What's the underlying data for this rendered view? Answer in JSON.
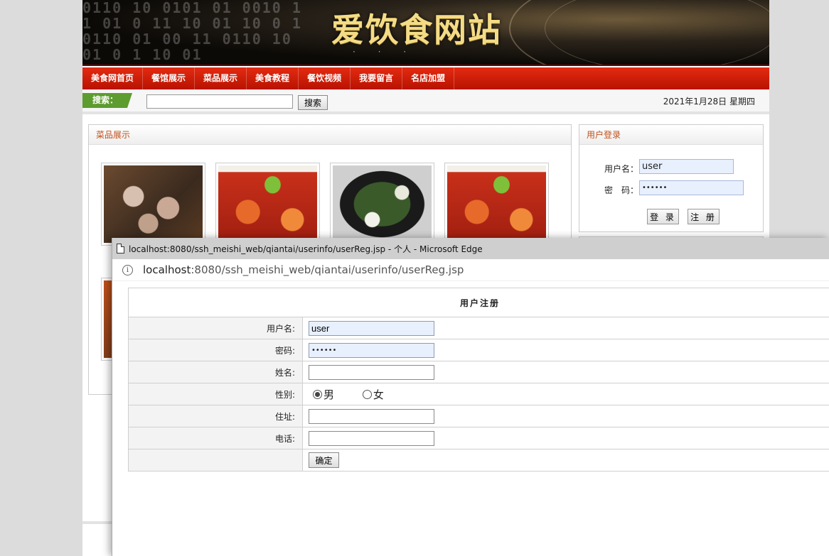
{
  "site": {
    "banner_title": "爱饮食网站",
    "nav": [
      "美食网首页",
      "餐馆展示",
      "菜品展示",
      "美食教程",
      "餐饮视频",
      "我要留言",
      "名店加盟"
    ],
    "search": {
      "label": "搜索：",
      "button": "搜索",
      "value": ""
    },
    "date": "2021年1月28日 星期四",
    "dishes_panel": {
      "title": "菜品展示"
    },
    "login_panel": {
      "title": "用户登录",
      "username_label": "用户名：",
      "username_value": "user",
      "password_label": "密　码：",
      "password_value": "••••••",
      "login_button": "登 录",
      "register_button": "注 册"
    }
  },
  "popup": {
    "window_title": "localhost:8080/ssh_meishi_web/qiantai/userinfo/userReg.jsp - 个人 - Microsoft Edge",
    "url_host": "localhost",
    "url_rest": ":8080/ssh_meishi_web/qiantai/userinfo/userReg.jsp",
    "form": {
      "title": "用户注册",
      "username_label": "用户名:",
      "username_value": "user",
      "password_label": "密码:",
      "password_value": "••••••",
      "name_label": "姓名:",
      "name_value": "",
      "gender_label": "性别:",
      "gender_options": [
        "男",
        "女"
      ],
      "gender_selected": "男",
      "address_label": "住址:",
      "address_value": "",
      "phone_label": "电话:",
      "phone_value": "",
      "submit_button": "确定"
    }
  },
  "colors": {
    "nav_red": "#d41e08",
    "search_green": "#5d9c2e",
    "panel_title": "#c0501a",
    "autofill": "#e8f0fe"
  }
}
